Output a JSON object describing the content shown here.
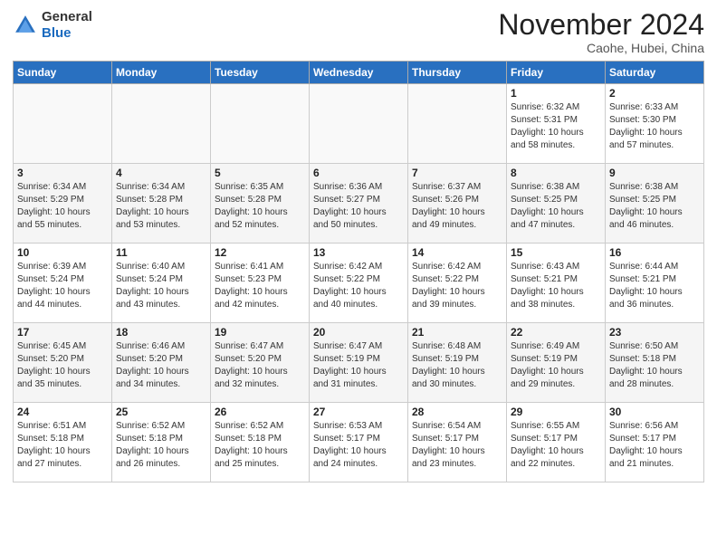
{
  "header": {
    "logo_line1": "General",
    "logo_line2": "Blue",
    "month": "November 2024",
    "location": "Caohe, Hubei, China"
  },
  "weekdays": [
    "Sunday",
    "Monday",
    "Tuesday",
    "Wednesday",
    "Thursday",
    "Friday",
    "Saturday"
  ],
  "weeks": [
    [
      {
        "day": "",
        "text": ""
      },
      {
        "day": "",
        "text": ""
      },
      {
        "day": "",
        "text": ""
      },
      {
        "day": "",
        "text": ""
      },
      {
        "day": "",
        "text": ""
      },
      {
        "day": "1",
        "text": "Sunrise: 6:32 AM\nSunset: 5:31 PM\nDaylight: 10 hours\nand 58 minutes."
      },
      {
        "day": "2",
        "text": "Sunrise: 6:33 AM\nSunset: 5:30 PM\nDaylight: 10 hours\nand 57 minutes."
      }
    ],
    [
      {
        "day": "3",
        "text": "Sunrise: 6:34 AM\nSunset: 5:29 PM\nDaylight: 10 hours\nand 55 minutes."
      },
      {
        "day": "4",
        "text": "Sunrise: 6:34 AM\nSunset: 5:28 PM\nDaylight: 10 hours\nand 53 minutes."
      },
      {
        "day": "5",
        "text": "Sunrise: 6:35 AM\nSunset: 5:28 PM\nDaylight: 10 hours\nand 52 minutes."
      },
      {
        "day": "6",
        "text": "Sunrise: 6:36 AM\nSunset: 5:27 PM\nDaylight: 10 hours\nand 50 minutes."
      },
      {
        "day": "7",
        "text": "Sunrise: 6:37 AM\nSunset: 5:26 PM\nDaylight: 10 hours\nand 49 minutes."
      },
      {
        "day": "8",
        "text": "Sunrise: 6:38 AM\nSunset: 5:25 PM\nDaylight: 10 hours\nand 47 minutes."
      },
      {
        "day": "9",
        "text": "Sunrise: 6:38 AM\nSunset: 5:25 PM\nDaylight: 10 hours\nand 46 minutes."
      }
    ],
    [
      {
        "day": "10",
        "text": "Sunrise: 6:39 AM\nSunset: 5:24 PM\nDaylight: 10 hours\nand 44 minutes."
      },
      {
        "day": "11",
        "text": "Sunrise: 6:40 AM\nSunset: 5:24 PM\nDaylight: 10 hours\nand 43 minutes."
      },
      {
        "day": "12",
        "text": "Sunrise: 6:41 AM\nSunset: 5:23 PM\nDaylight: 10 hours\nand 42 minutes."
      },
      {
        "day": "13",
        "text": "Sunrise: 6:42 AM\nSunset: 5:22 PM\nDaylight: 10 hours\nand 40 minutes."
      },
      {
        "day": "14",
        "text": "Sunrise: 6:42 AM\nSunset: 5:22 PM\nDaylight: 10 hours\nand 39 minutes."
      },
      {
        "day": "15",
        "text": "Sunrise: 6:43 AM\nSunset: 5:21 PM\nDaylight: 10 hours\nand 38 minutes."
      },
      {
        "day": "16",
        "text": "Sunrise: 6:44 AM\nSunset: 5:21 PM\nDaylight: 10 hours\nand 36 minutes."
      }
    ],
    [
      {
        "day": "17",
        "text": "Sunrise: 6:45 AM\nSunset: 5:20 PM\nDaylight: 10 hours\nand 35 minutes."
      },
      {
        "day": "18",
        "text": "Sunrise: 6:46 AM\nSunset: 5:20 PM\nDaylight: 10 hours\nand 34 minutes."
      },
      {
        "day": "19",
        "text": "Sunrise: 6:47 AM\nSunset: 5:20 PM\nDaylight: 10 hours\nand 32 minutes."
      },
      {
        "day": "20",
        "text": "Sunrise: 6:47 AM\nSunset: 5:19 PM\nDaylight: 10 hours\nand 31 minutes."
      },
      {
        "day": "21",
        "text": "Sunrise: 6:48 AM\nSunset: 5:19 PM\nDaylight: 10 hours\nand 30 minutes."
      },
      {
        "day": "22",
        "text": "Sunrise: 6:49 AM\nSunset: 5:19 PM\nDaylight: 10 hours\nand 29 minutes."
      },
      {
        "day": "23",
        "text": "Sunrise: 6:50 AM\nSunset: 5:18 PM\nDaylight: 10 hours\nand 28 minutes."
      }
    ],
    [
      {
        "day": "24",
        "text": "Sunrise: 6:51 AM\nSunset: 5:18 PM\nDaylight: 10 hours\nand 27 minutes."
      },
      {
        "day": "25",
        "text": "Sunrise: 6:52 AM\nSunset: 5:18 PM\nDaylight: 10 hours\nand 26 minutes."
      },
      {
        "day": "26",
        "text": "Sunrise: 6:52 AM\nSunset: 5:18 PM\nDaylight: 10 hours\nand 25 minutes."
      },
      {
        "day": "27",
        "text": "Sunrise: 6:53 AM\nSunset: 5:17 PM\nDaylight: 10 hours\nand 24 minutes."
      },
      {
        "day": "28",
        "text": "Sunrise: 6:54 AM\nSunset: 5:17 PM\nDaylight: 10 hours\nand 23 minutes."
      },
      {
        "day": "29",
        "text": "Sunrise: 6:55 AM\nSunset: 5:17 PM\nDaylight: 10 hours\nand 22 minutes."
      },
      {
        "day": "30",
        "text": "Sunrise: 6:56 AM\nSunset: 5:17 PM\nDaylight: 10 hours\nand 21 minutes."
      }
    ]
  ]
}
